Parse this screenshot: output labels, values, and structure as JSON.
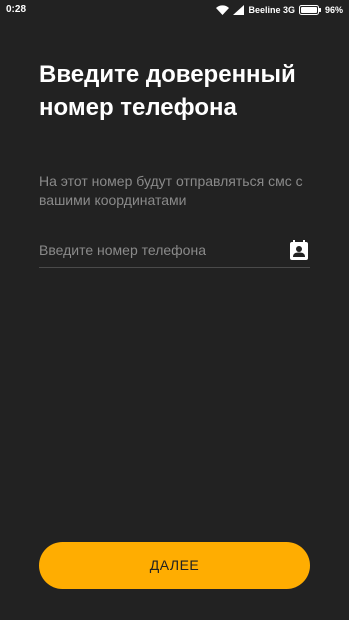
{
  "status_bar": {
    "time": "0:28",
    "carrier": "Beeline 3G",
    "battery": "96%",
    "icons": [
      "wifi-icon",
      "signal-icon",
      "battery-icon"
    ]
  },
  "main": {
    "title": "Введите доверенный номер телефона",
    "subtitle": "На этот номер будут отправляться смс с вашими координатами",
    "phone_input": {
      "value": "",
      "placeholder": "Введите номер телефона"
    },
    "contact_icon": "contact-book-icon",
    "next_button_label": "ДАЛЕЕ"
  },
  "colors": {
    "background": "#222222",
    "accent": "#ffad01",
    "text_primary": "#ffffff",
    "text_secondary": "#8a8a8a"
  }
}
